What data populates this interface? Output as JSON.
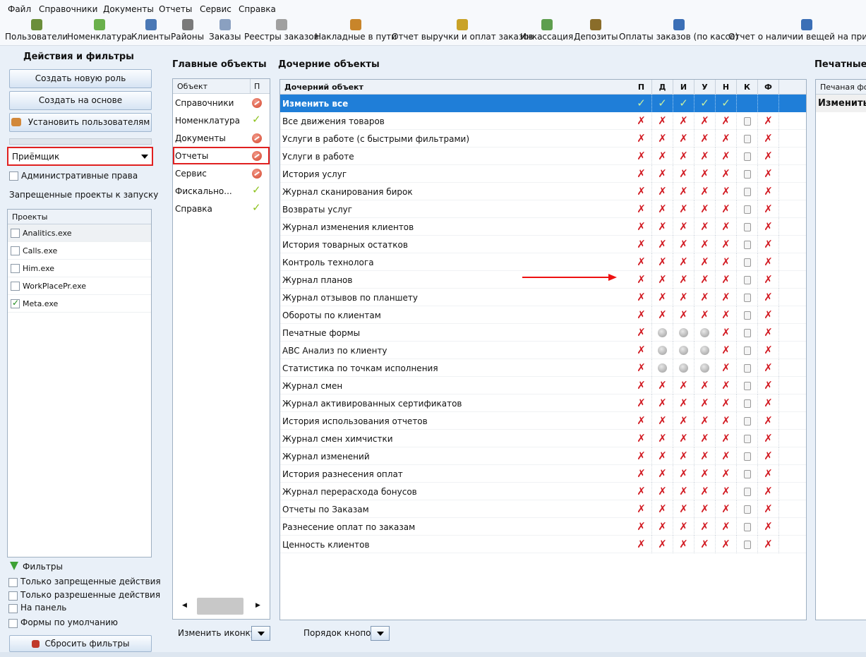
{
  "menu": [
    "Файл",
    "Справочники",
    "Документы",
    "Отчеты",
    "Сервис",
    "Справка"
  ],
  "toolbar": [
    {
      "label": "Пользователи",
      "icon": "users-icon",
      "color": "#6b8e3a"
    },
    {
      "label": "Номенклатура",
      "icon": "basket-icon",
      "color": "#6ab04c"
    },
    {
      "label": "Клиенты",
      "icon": "client-icon",
      "color": "#4a78b5"
    },
    {
      "label": "Районы",
      "icon": "area-icon",
      "color": "#7a7a7a"
    },
    {
      "label": "Заказы",
      "icon": "orders-icon",
      "color": "#8aa0c0"
    },
    {
      "label": "Реестры заказов",
      "icon": "register-icon",
      "color": "#a0a0a0"
    },
    {
      "label": "Накладные в пути",
      "icon": "truck-icon",
      "color": "#c8852a"
    },
    {
      "label": "Отчет выручки и оплат заказов",
      "icon": "money-icon",
      "color": "#c9a227"
    },
    {
      "label": "Инкассация",
      "icon": "cash-icon",
      "color": "#5e9e4e"
    },
    {
      "label": "Депозиты",
      "icon": "deposit-icon",
      "color": "#8a6d2a"
    },
    {
      "label": "Оплаты заказов (по кассе)",
      "icon": "cashbox-icon",
      "color": "#3b6fb6"
    },
    {
      "label": "Отчет о наличии вещей на приемн",
      "icon": "report-icon",
      "color": "#3b6fb6"
    }
  ],
  "left": {
    "title": "Действия и фильтры",
    "btn_create_role": "Создать новую роль",
    "btn_create_based": "Создать на основе",
    "btn_set_users": "Установить пользователям",
    "role_value": "Приёмщик",
    "admin_rights": "Административные права",
    "forbidden_title": "Запрещенные проекты к запуску",
    "projects_header": "Проекты",
    "projects": [
      {
        "name": "Analitics.exe",
        "checked": false
      },
      {
        "name": "Calls.exe",
        "checked": false
      },
      {
        "name": "Him.exe",
        "checked": false
      },
      {
        "name": "WorkPlacePr.exe",
        "checked": false
      },
      {
        "name": "Meta.exe",
        "checked": true
      }
    ],
    "filters_title": "Фильтры",
    "filters": [
      "Только запрещенные действия",
      "Только разрешенные действия",
      "На панель",
      "Формы по умолчанию"
    ],
    "btn_reset": "Сбросить фильтры"
  },
  "main": {
    "title": "Главные объекты",
    "col_object": "Объект",
    "col_p": "П",
    "rows": [
      {
        "label": "Справочники",
        "state": "red"
      },
      {
        "label": "Номенклатура",
        "state": "ok"
      },
      {
        "label": "Документы",
        "state": "red"
      },
      {
        "label": "Отчеты",
        "state": "red"
      },
      {
        "label": "Сервис",
        "state": "red"
      },
      {
        "label": "Фискально...",
        "state": "ok"
      },
      {
        "label": "Справка",
        "state": "ok"
      }
    ],
    "selected_index": 3,
    "change_icon_label": "Изменить иконку"
  },
  "child": {
    "title": "Дочерние объекты",
    "col_object": "Дочерний объект",
    "cols": [
      "П",
      "Д",
      "И",
      "У",
      "Н",
      "К",
      "Ф"
    ],
    "rows": [
      {
        "label": "Изменить все",
        "cells": [
          "ok",
          "ok",
          "ok",
          "ok",
          "ok",
          "",
          ""
        ]
      },
      {
        "label": "Все движения товаров",
        "cells": [
          "x",
          "x",
          "x",
          "x",
          "x",
          "s",
          "x"
        ]
      },
      {
        "label": "Услуги в работе (с быстрыми фильтрами)",
        "cells": [
          "x",
          "x",
          "x",
          "x",
          "x",
          "s",
          "x"
        ]
      },
      {
        "label": "Услуги в работе",
        "cells": [
          "x",
          "x",
          "x",
          "x",
          "x",
          "s",
          "x"
        ]
      },
      {
        "label": "История услуг",
        "cells": [
          "x",
          "x",
          "x",
          "x",
          "x",
          "s",
          "x"
        ]
      },
      {
        "label": "Журнал сканирования бирок",
        "cells": [
          "x",
          "x",
          "x",
          "x",
          "x",
          "s",
          "x"
        ]
      },
      {
        "label": "Возвраты услуг",
        "cells": [
          "x",
          "x",
          "x",
          "x",
          "x",
          "s",
          "x"
        ]
      },
      {
        "label": "Журнал изменения клиентов",
        "cells": [
          "x",
          "x",
          "x",
          "x",
          "x",
          "s",
          "x"
        ]
      },
      {
        "label": "История товарных остатков",
        "cells": [
          "x",
          "x",
          "x",
          "x",
          "x",
          "s",
          "x"
        ]
      },
      {
        "label": "Контроль технолога",
        "cells": [
          "x",
          "x",
          "x",
          "x",
          "x",
          "s",
          "x"
        ]
      },
      {
        "label": "Журнал планов",
        "cells": [
          "x",
          "x",
          "x",
          "x",
          "x",
          "s",
          "x"
        ]
      },
      {
        "label": "Журнал отзывов по планшету",
        "cells": [
          "x",
          "x",
          "x",
          "x",
          "x",
          "s",
          "x"
        ]
      },
      {
        "label": "Обороты по клиентам",
        "cells": [
          "x",
          "x",
          "x",
          "x",
          "x",
          "s",
          "x"
        ]
      },
      {
        "label": "Печатные формы",
        "cells": [
          "x",
          "c",
          "c",
          "c",
          "x",
          "s",
          "x"
        ]
      },
      {
        "label": "ABC Анализ по клиенту",
        "cells": [
          "x",
          "c",
          "c",
          "c",
          "x",
          "s",
          "x"
        ]
      },
      {
        "label": "Статистика по точкам исполнения",
        "cells": [
          "x",
          "c",
          "c",
          "c",
          "x",
          "s",
          "x"
        ]
      },
      {
        "label": "Журнал смен",
        "cells": [
          "x",
          "x",
          "x",
          "x",
          "x",
          "s",
          "x"
        ]
      },
      {
        "label": "Журнал активированных сертификатов",
        "cells": [
          "x",
          "x",
          "x",
          "x",
          "x",
          "s",
          "x"
        ]
      },
      {
        "label": "История использования отчетов",
        "cells": [
          "x",
          "x",
          "x",
          "x",
          "x",
          "s",
          "x"
        ]
      },
      {
        "label": "Журнал смен химчистки",
        "cells": [
          "x",
          "x",
          "x",
          "x",
          "x",
          "s",
          "x"
        ]
      },
      {
        "label": "Журнал изменений",
        "cells": [
          "x",
          "x",
          "x",
          "x",
          "x",
          "s",
          "x"
        ]
      },
      {
        "label": "История разнесения оплат",
        "cells": [
          "x",
          "x",
          "x",
          "x",
          "x",
          "s",
          "x"
        ]
      },
      {
        "label": "Журнал перерасхода бонусов",
        "cells": [
          "x",
          "x",
          "x",
          "x",
          "x",
          "s",
          "x"
        ]
      },
      {
        "label": "Отчеты по Заказам",
        "cells": [
          "x",
          "x",
          "x",
          "x",
          "x",
          "s",
          "x"
        ]
      },
      {
        "label": "Разнесение оплат по заказам",
        "cells": [
          "x",
          "x",
          "x",
          "x",
          "x",
          "s",
          "x"
        ]
      },
      {
        "label": "Ценность клиентов",
        "cells": [
          "x",
          "x",
          "x",
          "x",
          "x",
          "s",
          "x"
        ]
      }
    ],
    "order_label": "Порядок кнопок"
  },
  "print": {
    "title": "Печатные ф",
    "col": "Печаная фор",
    "row": "Изменить в"
  },
  "colors": {
    "selected_row": "#1f7ed8",
    "deny": "#d21a22",
    "allow": "#8dc21e",
    "highlight": "#e02020"
  }
}
